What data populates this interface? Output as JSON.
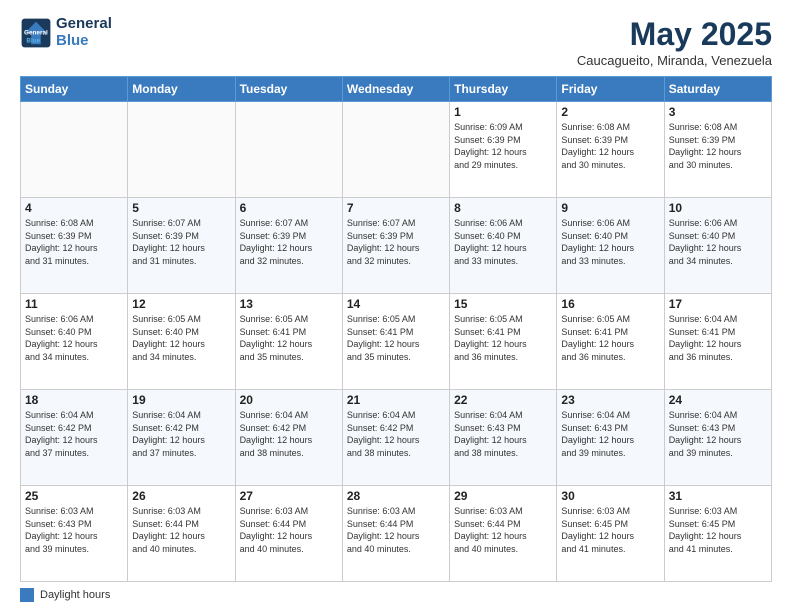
{
  "logo": {
    "line1": "General",
    "line2": "Blue"
  },
  "title": "May 2025",
  "location": "Caucagueito, Miranda, Venezuela",
  "days_of_week": [
    "Sunday",
    "Monday",
    "Tuesday",
    "Wednesday",
    "Thursday",
    "Friday",
    "Saturday"
  ],
  "legend_label": "Daylight hours",
  "weeks": [
    [
      {
        "day": "",
        "info": ""
      },
      {
        "day": "",
        "info": ""
      },
      {
        "day": "",
        "info": ""
      },
      {
        "day": "",
        "info": ""
      },
      {
        "day": "1",
        "info": "Sunrise: 6:09 AM\nSunset: 6:39 PM\nDaylight: 12 hours\nand 29 minutes."
      },
      {
        "day": "2",
        "info": "Sunrise: 6:08 AM\nSunset: 6:39 PM\nDaylight: 12 hours\nand 30 minutes."
      },
      {
        "day": "3",
        "info": "Sunrise: 6:08 AM\nSunset: 6:39 PM\nDaylight: 12 hours\nand 30 minutes."
      }
    ],
    [
      {
        "day": "4",
        "info": "Sunrise: 6:08 AM\nSunset: 6:39 PM\nDaylight: 12 hours\nand 31 minutes."
      },
      {
        "day": "5",
        "info": "Sunrise: 6:07 AM\nSunset: 6:39 PM\nDaylight: 12 hours\nand 31 minutes."
      },
      {
        "day": "6",
        "info": "Sunrise: 6:07 AM\nSunset: 6:39 PM\nDaylight: 12 hours\nand 32 minutes."
      },
      {
        "day": "7",
        "info": "Sunrise: 6:07 AM\nSunset: 6:39 PM\nDaylight: 12 hours\nand 32 minutes."
      },
      {
        "day": "8",
        "info": "Sunrise: 6:06 AM\nSunset: 6:40 PM\nDaylight: 12 hours\nand 33 minutes."
      },
      {
        "day": "9",
        "info": "Sunrise: 6:06 AM\nSunset: 6:40 PM\nDaylight: 12 hours\nand 33 minutes."
      },
      {
        "day": "10",
        "info": "Sunrise: 6:06 AM\nSunset: 6:40 PM\nDaylight: 12 hours\nand 34 minutes."
      }
    ],
    [
      {
        "day": "11",
        "info": "Sunrise: 6:06 AM\nSunset: 6:40 PM\nDaylight: 12 hours\nand 34 minutes."
      },
      {
        "day": "12",
        "info": "Sunrise: 6:05 AM\nSunset: 6:40 PM\nDaylight: 12 hours\nand 34 minutes."
      },
      {
        "day": "13",
        "info": "Sunrise: 6:05 AM\nSunset: 6:41 PM\nDaylight: 12 hours\nand 35 minutes."
      },
      {
        "day": "14",
        "info": "Sunrise: 6:05 AM\nSunset: 6:41 PM\nDaylight: 12 hours\nand 35 minutes."
      },
      {
        "day": "15",
        "info": "Sunrise: 6:05 AM\nSunset: 6:41 PM\nDaylight: 12 hours\nand 36 minutes."
      },
      {
        "day": "16",
        "info": "Sunrise: 6:05 AM\nSunset: 6:41 PM\nDaylight: 12 hours\nand 36 minutes."
      },
      {
        "day": "17",
        "info": "Sunrise: 6:04 AM\nSunset: 6:41 PM\nDaylight: 12 hours\nand 36 minutes."
      }
    ],
    [
      {
        "day": "18",
        "info": "Sunrise: 6:04 AM\nSunset: 6:42 PM\nDaylight: 12 hours\nand 37 minutes."
      },
      {
        "day": "19",
        "info": "Sunrise: 6:04 AM\nSunset: 6:42 PM\nDaylight: 12 hours\nand 37 minutes."
      },
      {
        "day": "20",
        "info": "Sunrise: 6:04 AM\nSunset: 6:42 PM\nDaylight: 12 hours\nand 38 minutes."
      },
      {
        "day": "21",
        "info": "Sunrise: 6:04 AM\nSunset: 6:42 PM\nDaylight: 12 hours\nand 38 minutes."
      },
      {
        "day": "22",
        "info": "Sunrise: 6:04 AM\nSunset: 6:43 PM\nDaylight: 12 hours\nand 38 minutes."
      },
      {
        "day": "23",
        "info": "Sunrise: 6:04 AM\nSunset: 6:43 PM\nDaylight: 12 hours\nand 39 minutes."
      },
      {
        "day": "24",
        "info": "Sunrise: 6:04 AM\nSunset: 6:43 PM\nDaylight: 12 hours\nand 39 minutes."
      }
    ],
    [
      {
        "day": "25",
        "info": "Sunrise: 6:03 AM\nSunset: 6:43 PM\nDaylight: 12 hours\nand 39 minutes."
      },
      {
        "day": "26",
        "info": "Sunrise: 6:03 AM\nSunset: 6:44 PM\nDaylight: 12 hours\nand 40 minutes."
      },
      {
        "day": "27",
        "info": "Sunrise: 6:03 AM\nSunset: 6:44 PM\nDaylight: 12 hours\nand 40 minutes."
      },
      {
        "day": "28",
        "info": "Sunrise: 6:03 AM\nSunset: 6:44 PM\nDaylight: 12 hours\nand 40 minutes."
      },
      {
        "day": "29",
        "info": "Sunrise: 6:03 AM\nSunset: 6:44 PM\nDaylight: 12 hours\nand 40 minutes."
      },
      {
        "day": "30",
        "info": "Sunrise: 6:03 AM\nSunset: 6:45 PM\nDaylight: 12 hours\nand 41 minutes."
      },
      {
        "day": "31",
        "info": "Sunrise: 6:03 AM\nSunset: 6:45 PM\nDaylight: 12 hours\nand 41 minutes."
      }
    ]
  ]
}
